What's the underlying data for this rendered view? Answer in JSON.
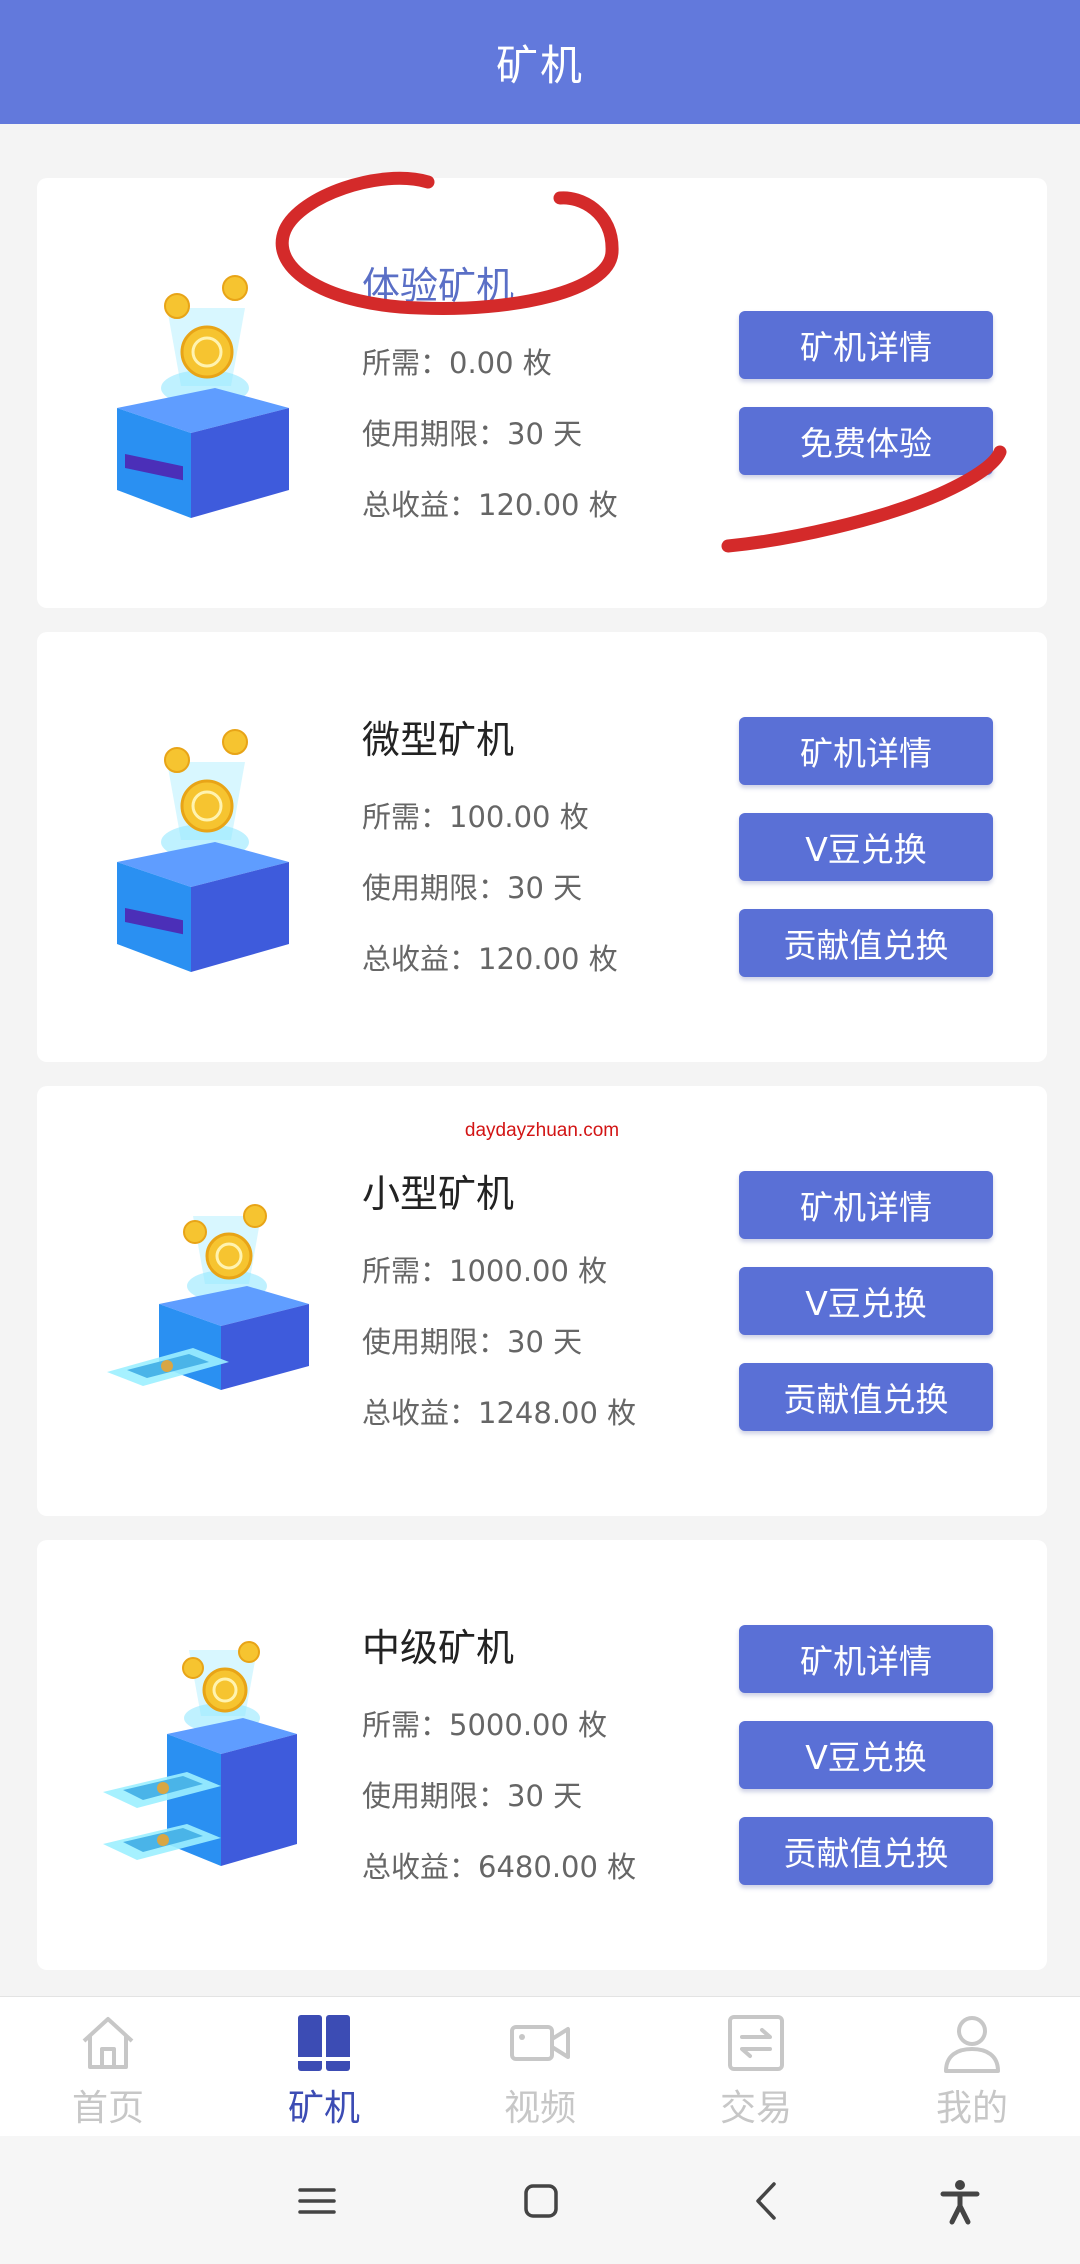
{
  "header": {
    "title": "矿机"
  },
  "watermark": "daydayzhuan.com",
  "labels": {
    "price": "所需：",
    "period": "使用期限：",
    "income": "总收益："
  },
  "cards": [
    {
      "name": "体验矿机",
      "price": "0.00 枚",
      "period": "30 天",
      "income": "120.00 枚",
      "buttons": [
        "矿机详情",
        "免费体验"
      ]
    },
    {
      "name": "微型矿机",
      "price": "100.00 枚",
      "period": "30 天",
      "income": "120.00 枚",
      "buttons": [
        "矿机详情",
        "V豆兑换",
        "贡献值兑换"
      ]
    },
    {
      "name": "小型矿机",
      "price": "1000.00 枚",
      "period": "30 天",
      "income": "1248.00 枚",
      "buttons": [
        "矿机详情",
        "V豆兑换",
        "贡献值兑换"
      ]
    },
    {
      "name": "中级矿机",
      "price": "5000.00 枚",
      "period": "30 天",
      "income": "6480.00 枚",
      "buttons": [
        "矿机详情",
        "V豆兑换",
        "贡献值兑换"
      ]
    }
  ],
  "tabs": [
    {
      "label": "首页",
      "icon": "home-icon"
    },
    {
      "label": "矿机",
      "icon": "mining-machine-icon"
    },
    {
      "label": "视频",
      "icon": "video-camera-icon"
    },
    {
      "label": "交易",
      "icon": "exchange-icon"
    },
    {
      "label": "我的",
      "icon": "person-icon"
    }
  ],
  "active_tab": "矿机",
  "colors": {
    "header": "#6279dc",
    "button": "#5a70d6",
    "active_tab": "#3c4cb4",
    "inactive_tab": "#c7c7c7",
    "annotation": "#d42a2a"
  },
  "system_nav": [
    "menu-icon",
    "home-square-icon",
    "back-icon",
    "accessibility-icon"
  ]
}
